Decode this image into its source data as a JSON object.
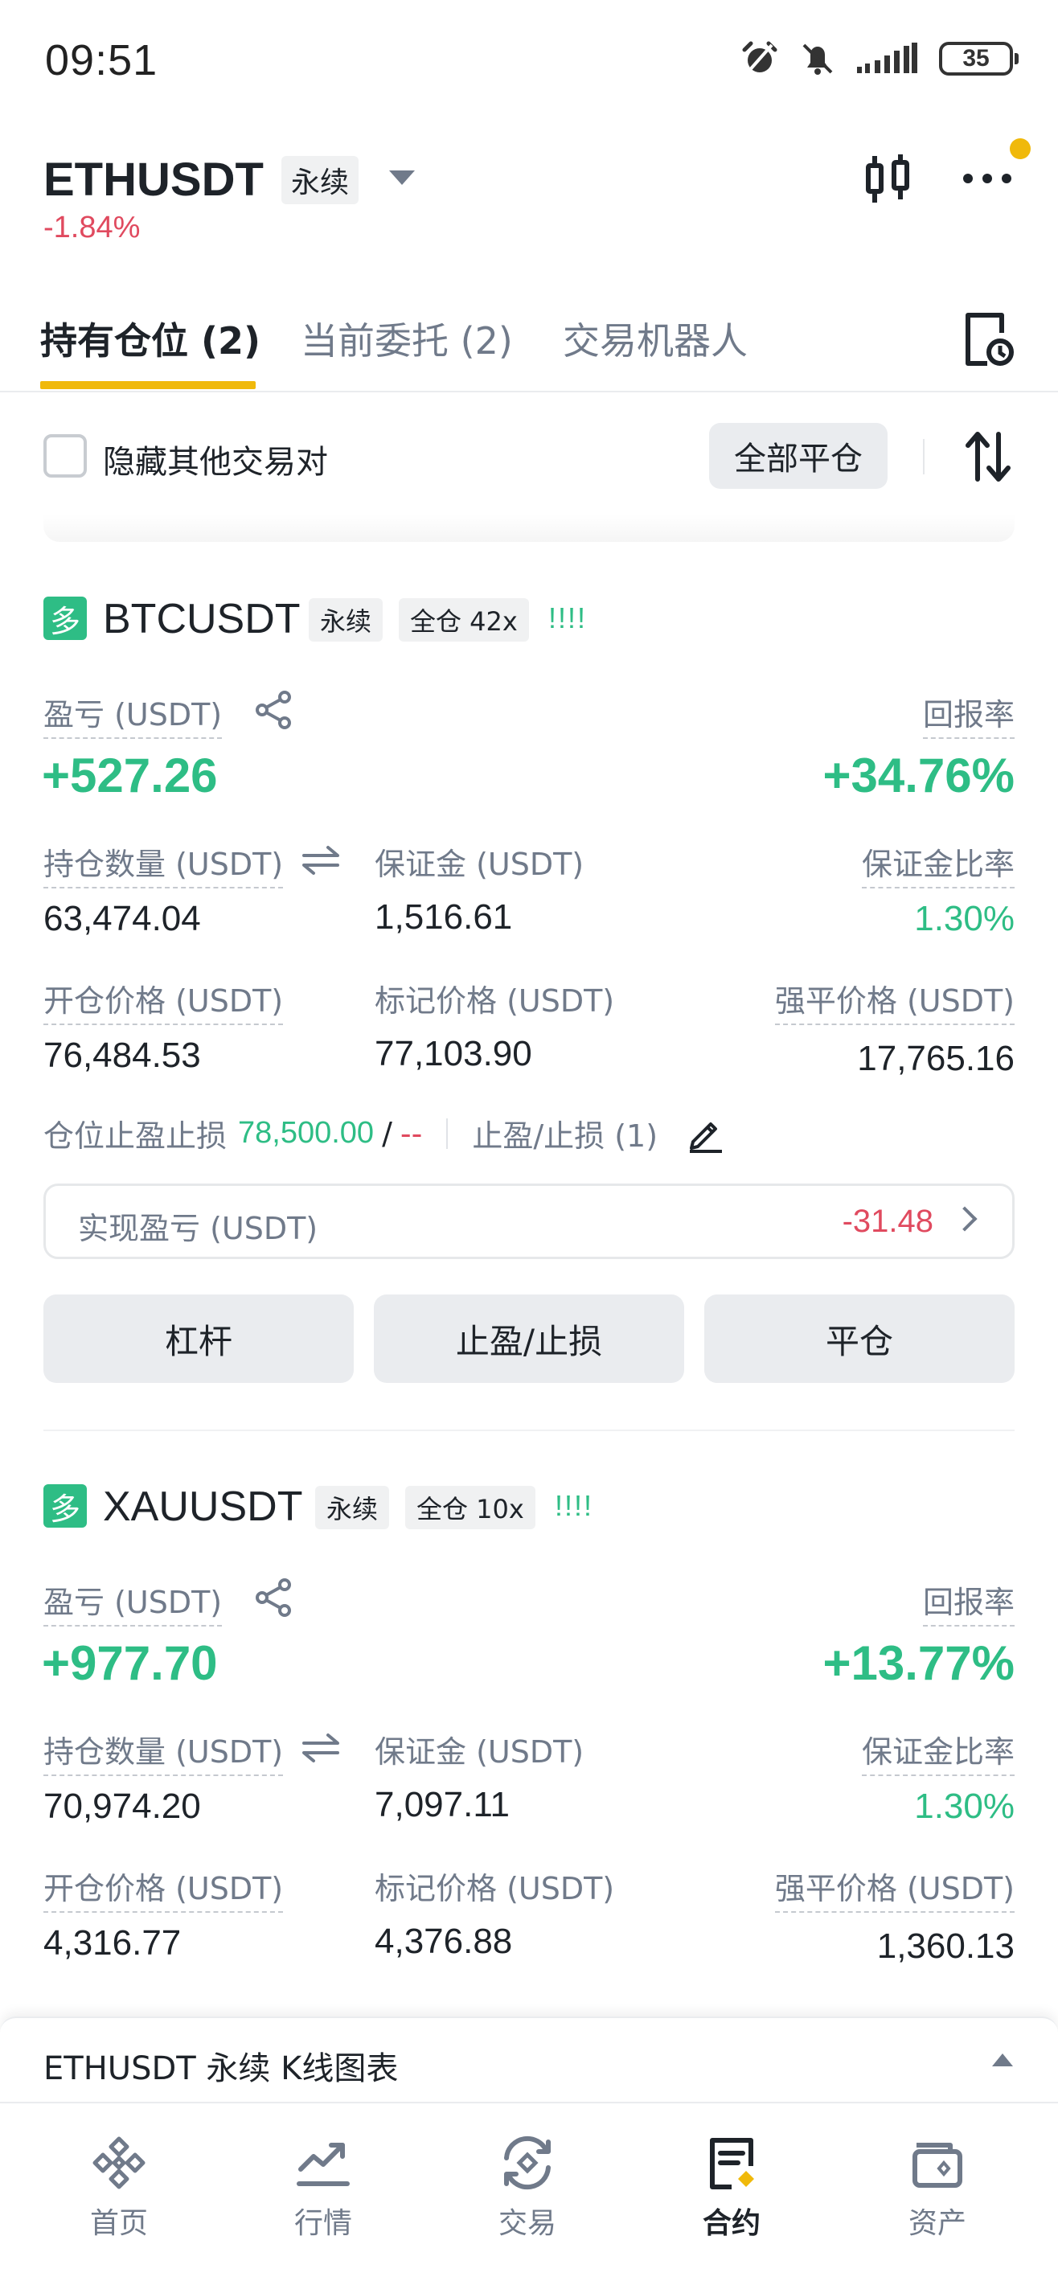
{
  "status": {
    "time": "09:51",
    "battery": "35"
  },
  "header": {
    "symbol": "ETHUSDT",
    "perp_tag": "永续",
    "change": "-1.84%"
  },
  "tabs": [
    {
      "label": "持有仓位 (2)",
      "active": true
    },
    {
      "label": "当前委托 (2)",
      "active": false
    },
    {
      "label": "交易机器人",
      "active": false
    }
  ],
  "filter": {
    "hide_label": "隐藏其他交易对",
    "close_all": "全部平仓"
  },
  "positions": [
    {
      "side": "多",
      "symbol": "BTCUSDT",
      "type": "永续",
      "margin_mode": "全仓 42x",
      "bars": "!!!!",
      "pnl_label": "盈亏 (USDT)",
      "pnl": "+527.26",
      "roe_label": "回报率",
      "roe": "+34.76%",
      "size_label": "持仓数量 (USDT)",
      "size": "63,474.04",
      "margin_label": "保证金 (USDT)",
      "margin": "1,516.61",
      "margin_ratio_label": "保证金比率",
      "margin_ratio": "1.30%",
      "entry_label": "开仓价格 (USDT)",
      "entry": "76,484.53",
      "mark_label": "标记价格 (USDT)",
      "mark": "77,103.90",
      "liq_label": "强平价格 (USDT)",
      "liq": "17,765.16",
      "tpsl_label": "仓位止盈止损",
      "tp": "78,500.00",
      "slash": "/",
      "sl": "--",
      "tpsl_orders": "止盈/止损 (1)",
      "realized_label": "实现盈亏 (USDT)",
      "realized": "-31.48",
      "buttons": [
        "杠杆",
        "止盈/止损",
        "平仓"
      ]
    },
    {
      "side": "多",
      "symbol": "XAUUSDT",
      "type": "永续",
      "margin_mode": "全仓 10x",
      "bars": "!!!!",
      "pnl_label": "盈亏 (USDT)",
      "pnl": "+977.70",
      "roe_label": "回报率",
      "roe": "+13.77%",
      "size_label": "持仓数量 (USDT)",
      "size": "70,974.20",
      "margin_label": "保证金 (USDT)",
      "margin": "7,097.11",
      "margin_ratio_label": "保证金比率",
      "margin_ratio": "1.30%",
      "entry_label": "开仓价格 (USDT)",
      "entry": "4,316.77",
      "mark_label": "标记价格 (USDT)",
      "mark": "4,376.88",
      "liq_label": "强平价格 (USDT)",
      "liq": "1,360.13"
    }
  ],
  "kline_bar": {
    "label": "ETHUSDT 永续 K线图表"
  },
  "nav": [
    {
      "label": "首页",
      "icon": "binance-logo-icon",
      "active": false
    },
    {
      "label": "行情",
      "icon": "market-chart-icon",
      "active": false
    },
    {
      "label": "交易",
      "icon": "trade-swap-icon",
      "active": false
    },
    {
      "label": "合约",
      "icon": "futures-doc-icon",
      "active": true
    },
    {
      "label": "资产",
      "icon": "wallet-icon",
      "active": false
    }
  ],
  "colors": {
    "accent": "#F0B90B",
    "green": "#2EBD85",
    "red": "#E04A5F",
    "gray": "#707A8A"
  }
}
